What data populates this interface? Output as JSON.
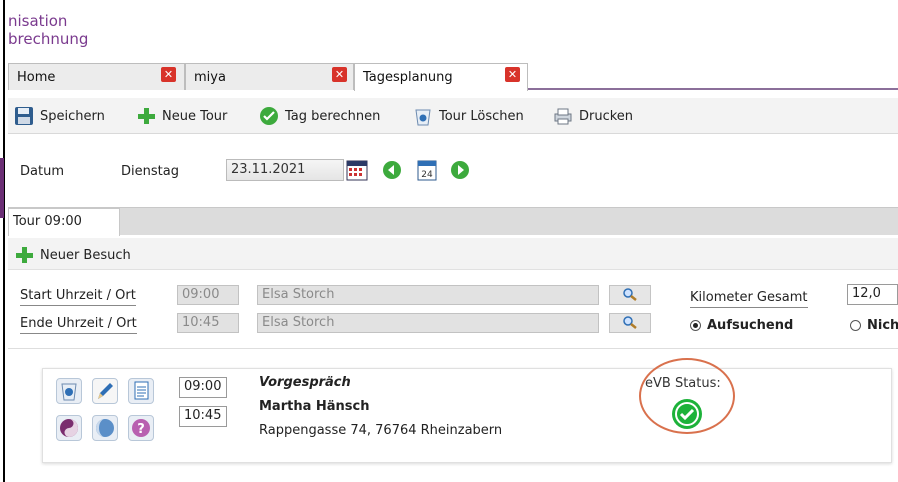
{
  "app": {
    "header_line1": "nisation",
    "header_line2": "brechnung"
  },
  "tabs": [
    {
      "label": "Home"
    },
    {
      "label": "miya"
    },
    {
      "label": "Tagesplanung"
    }
  ],
  "toolbar": {
    "save": "Speichern",
    "new_tour": "Neue Tour",
    "calc_day": "Tag berechnen",
    "delete_tour": "Tour Löschen",
    "print": "Drucken"
  },
  "date": {
    "label": "Datum",
    "weekday": "Dienstag",
    "value": "23.11.2021",
    "calendar_day": "24"
  },
  "tour_tab": "Tour 09:00",
  "new_visit": "Neuer Besuch",
  "start": {
    "label": "Start Uhrzeit / Ort",
    "time": "09:00",
    "place": "Elsa Storch"
  },
  "end": {
    "label": "Ende Uhrzeit / Ort",
    "time": "10:45",
    "place": "Elsa Storch"
  },
  "km": {
    "label": "Kilometer Gesamt",
    "value": "12,0"
  },
  "mode": {
    "option1": "Aufsuchend",
    "option2": "Nich"
  },
  "visit": {
    "start_time": "09:00",
    "end_time": "10:45",
    "type": "Vorgespräch",
    "name": "Martha Hänsch",
    "address": "Rappengasse 74, 76764 Rheinzabern",
    "status_label": "eVB Status:"
  },
  "colors": {
    "accent_purple": "#7a3a8e",
    "status_green": "#1db23a",
    "highlight_ring": "#d9714d"
  }
}
